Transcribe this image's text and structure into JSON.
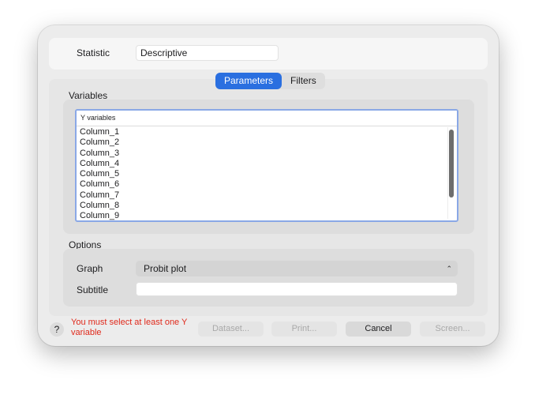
{
  "header": {
    "statistic_label": "Statistic",
    "statistic_value": "Descriptive"
  },
  "tabs": [
    {
      "label": "Parameters",
      "active": true
    },
    {
      "label": "Filters",
      "active": false
    }
  ],
  "variables": {
    "section_label": "Variables",
    "list_header": "Y variables",
    "items": [
      "Column_1",
      "Column_2",
      "Column_3",
      "Column_4",
      "Column_5",
      "Column_6",
      "Column_7",
      "Column_8",
      "Column_9"
    ]
  },
  "options": {
    "section_label": "Options",
    "graph_label": "Graph",
    "graph_value": "Probit plot",
    "subtitle_label": "Subtitle",
    "subtitle_value": ""
  },
  "footer": {
    "help_label": "?",
    "error_message": "You must select at least one Y variable",
    "buttons": {
      "dataset": "Dataset...",
      "print": "Print...",
      "cancel": "Cancel",
      "screen": "Screen..."
    }
  },
  "colors": {
    "accent": "#2a6fe0",
    "error": "#e0291b",
    "focus_ring": "#8aa8e6"
  },
  "icons": {
    "help": "help-icon",
    "select_chevron": "chevron-up-down-icon"
  }
}
